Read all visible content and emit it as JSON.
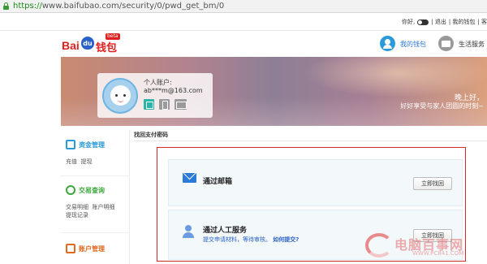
{
  "browser": {
    "url_protocol": "https://",
    "url_host": "www.baifubao.com",
    "url_path": "/security/0/pwd_get_bm/0"
  },
  "topbar": {
    "hello": "你好,",
    "logout": "退出",
    "my_wallet": "我的钱包",
    "more": "客服"
  },
  "header": {
    "logo": {
      "brand": "Bai",
      "paw": "du",
      "product": "钱包",
      "badge": "beta"
    },
    "nav_wallet": "我的钱包",
    "nav_life": "生活服务"
  },
  "account": {
    "label": "个人账户:",
    "email": "ab***m@163.com"
  },
  "banner": {
    "greeting": "晚上好，",
    "subtitle": "好好享受与家人团圆的时刻~"
  },
  "sidebar": {
    "groups": [
      {
        "title": "资金管理",
        "color": "#2a9ad8",
        "links": [
          "充值",
          "提现"
        ]
      },
      {
        "title": "交易查询",
        "color": "#3aa83a",
        "links": [
          "交易明细",
          "账户明细",
          "提现记录"
        ]
      },
      {
        "title": "账户管理",
        "color": "#e06a20",
        "links": []
      }
    ]
  },
  "main": {
    "breadcrumb": "找回支付密码",
    "options": [
      {
        "title": "通过邮箱",
        "button": "立即找回"
      },
      {
        "title": "通过人工服务",
        "desc": "提交申请材料，等待审核。",
        "desc_link": "如何提交?",
        "button": "立即找回"
      }
    ]
  },
  "watermark": {
    "title": "电脑百事网",
    "url": "WWW.PC841.COM"
  },
  "colors": {
    "accent_blue": "#2a7ad8",
    "baidu_red": "#e02020",
    "highlight_red": "#d82828"
  }
}
